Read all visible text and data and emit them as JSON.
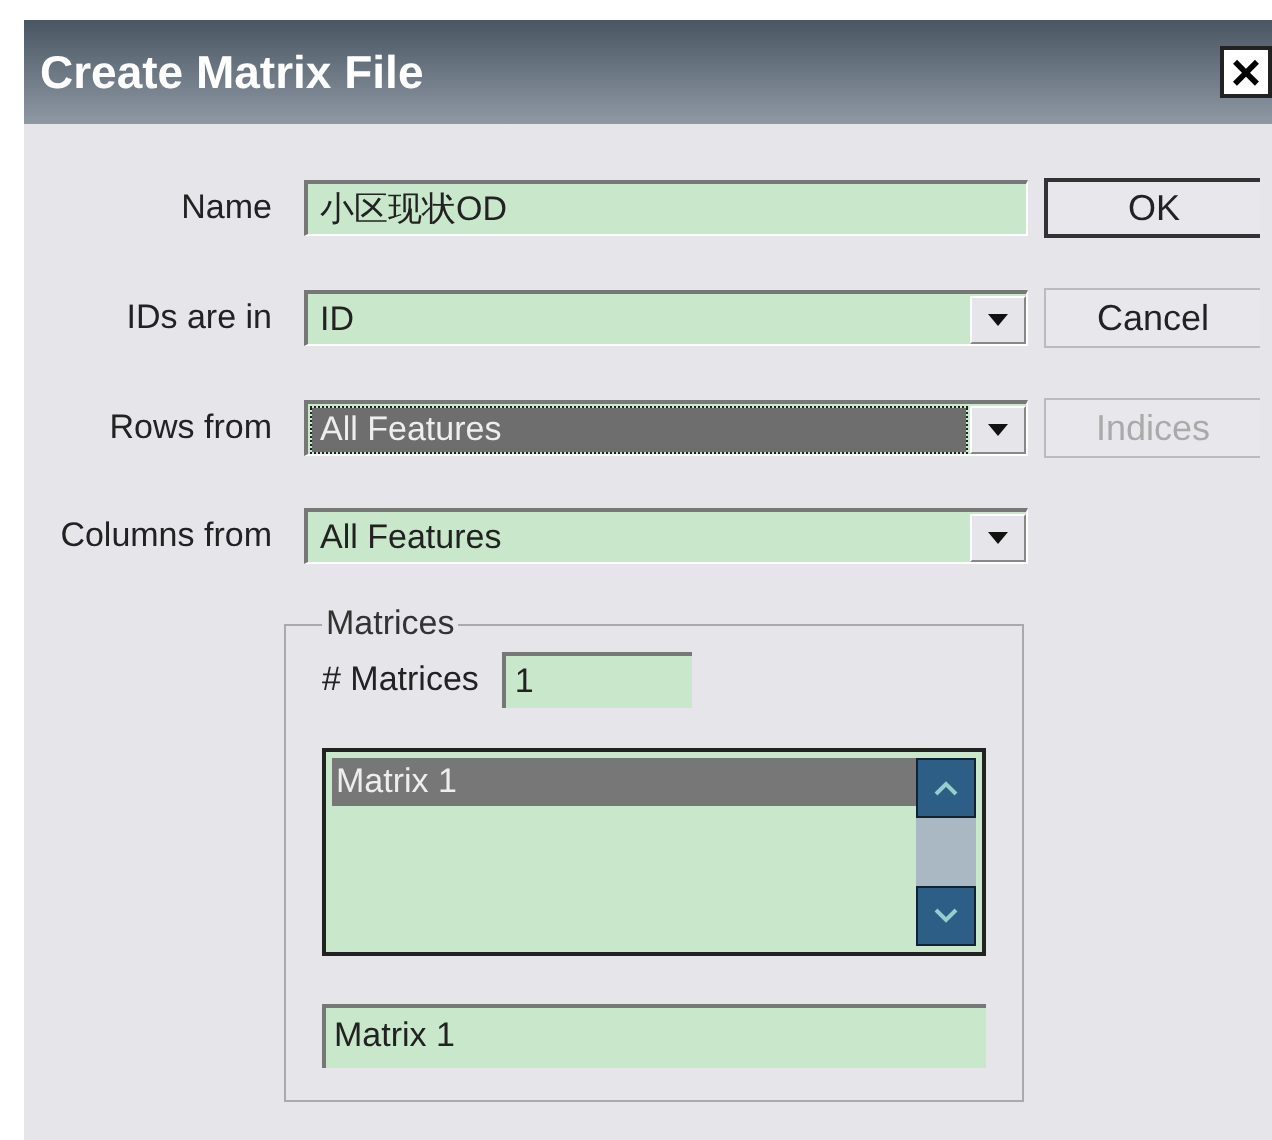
{
  "window": {
    "title": "Create Matrix File",
    "close": "×"
  },
  "fields": [
    {
      "label": "Name",
      "kind": "text",
      "value": "小区现状OD",
      "selected": false
    },
    {
      "label": "IDs are in",
      "kind": "dropdown",
      "value": "ID",
      "selected": false
    },
    {
      "label": "Rows from",
      "kind": "dropdown",
      "value": "All Features",
      "selected": true
    },
    {
      "label": "Columns from",
      "kind": "dropdown",
      "value": "All Features",
      "selected": false
    }
  ],
  "buttons": [
    {
      "label": "OK",
      "default": true,
      "disabled": false
    },
    {
      "label": "Cancel",
      "default": false,
      "disabled": false
    },
    {
      "label": "Indices",
      "default": false,
      "disabled": true
    }
  ],
  "matrices": {
    "title": "Matrices",
    "count_label": "# Matrices",
    "count": "1",
    "list": [
      {
        "label": "Matrix 1",
        "selected": true
      }
    ],
    "name_value": "Matrix 1"
  }
}
